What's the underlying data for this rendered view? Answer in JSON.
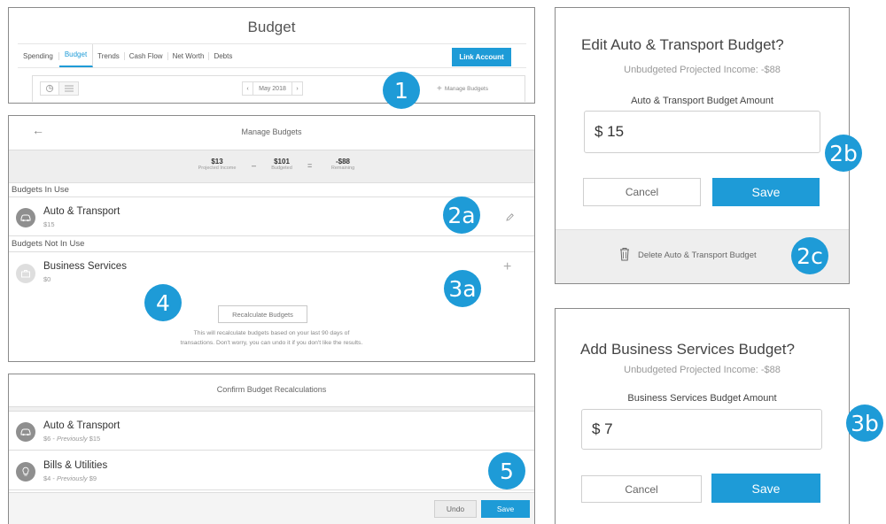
{
  "panel1": {
    "title": "Budget",
    "tabs": [
      "Spending",
      "Budget",
      "Trends",
      "Cash Flow",
      "Net Worth",
      "Debts"
    ],
    "link_account": "Link Account",
    "month": "May 2018",
    "prev": "‹",
    "next": "›",
    "manage_budgets": "Manage Budgets"
  },
  "panel2": {
    "back": "←",
    "title": "Manage Budgets",
    "income_value": "$13",
    "income_label": "Projected Income",
    "minus": "–",
    "budgeted_value": "$101",
    "budgeted_label": "Budgeted",
    "equals": "=",
    "remaining_value": "-$88",
    "remaining_label": "Remaining",
    "in_use_header": "Budgets In Use",
    "auto_name": "Auto & Transport",
    "auto_amount": "$15",
    "not_in_use_header": "Budgets Not In Use",
    "business_name": "Business Services",
    "business_amount": "$0",
    "recalc_button": "Recalculate Budgets",
    "recalc_note_1": "This will recalculate budgets based on your last 90 days of",
    "recalc_note_2": "transactions. Don't worry, you can undo it if you don't like the results."
  },
  "panel3": {
    "title": "Confirm Budget Recalculations",
    "row1_name": "Auto & Transport",
    "row1_new": "$6 - ",
    "row1_prev_label": "Previously",
    "row1_prev": " $15",
    "row2_name": "Bills & Utilities",
    "row2_new": "$4 - ",
    "row2_prev_label": "Previously",
    "row2_prev": " $9",
    "undo": "Undo",
    "save": "Save"
  },
  "panel4": {
    "title": "Edit Auto & Transport Budget?",
    "subtitle": "Unbudgeted Projected Income: -$88",
    "field_label": "Auto & Transport Budget Amount",
    "field_value": "$ 15",
    "cancel": "Cancel",
    "save": "Save",
    "delete": "Delete Auto & Transport Budget"
  },
  "panel5": {
    "title": "Add Business Services Budget?",
    "subtitle": "Unbudgeted Projected Income: -$88",
    "field_label": "Business Services Budget Amount",
    "field_value": "$ 7",
    "cancel": "Cancel",
    "save": "Save"
  },
  "badges": {
    "b1": "1",
    "b2a": "2a",
    "b3a": "3a",
    "b4": "4",
    "b5": "5",
    "b2b": "2b",
    "b2c": "2c",
    "b3b": "3b"
  },
  "colors": {
    "accent": "#1e9bd7",
    "border": "#8a8a8a",
    "band": "#eeeeee"
  },
  "icons": [
    "car-icon",
    "briefcase-icon",
    "bulb-icon",
    "pencil-icon",
    "plus-icon",
    "trash-icon",
    "pie-chart-icon",
    "list-icon"
  ]
}
